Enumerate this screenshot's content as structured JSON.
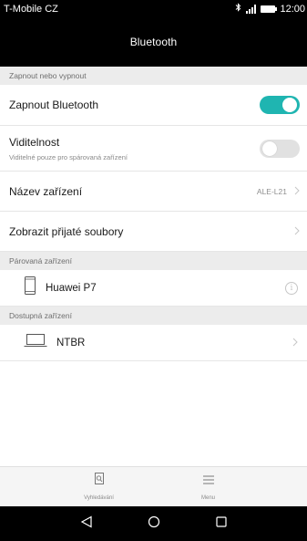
{
  "status_bar": {
    "carrier": "T-Mobile CZ",
    "time": "12:00"
  },
  "header": {
    "title": "Bluetooth"
  },
  "sections": {
    "toggle_header": "Zapnout nebo vypnout",
    "paired_header": "Párovaná zařízení",
    "available_header": "Dostupná zařízení"
  },
  "settings": {
    "bluetooth_label": "Zapnout Bluetooth",
    "bluetooth_on": true,
    "visibility_label": "Viditelnost",
    "visibility_sub": "Viditelné pouze pro spárovaná zařízení",
    "visibility_on": false,
    "device_name_label": "Název zařízení",
    "device_name_value": "ALE-L21",
    "received_files_label": "Zobrazit přijaté soubory"
  },
  "paired_devices": [
    {
      "name": "Huawei P7",
      "icon": "phone-icon"
    }
  ],
  "available_devices": [
    {
      "name": "NTBR",
      "icon": "laptop-icon"
    }
  ],
  "toolbar": {
    "search_label": "Vyhledávání",
    "menu_label": "Menu"
  },
  "colors": {
    "accent": "#1fb5b1",
    "header_bg": "#000000",
    "section_bg": "#ececec"
  }
}
